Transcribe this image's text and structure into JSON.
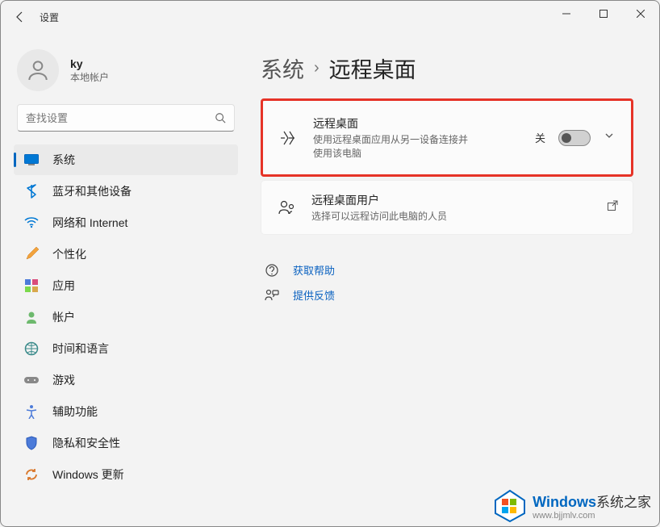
{
  "window": {
    "title": "设置"
  },
  "user": {
    "name": "ky",
    "subtitle": "本地帐户"
  },
  "search": {
    "placeholder": "查找设置"
  },
  "nav": {
    "items": [
      {
        "label": "系统"
      },
      {
        "label": "蓝牙和其他设备"
      },
      {
        "label": "网络和 Internet"
      },
      {
        "label": "个性化"
      },
      {
        "label": "应用"
      },
      {
        "label": "帐户"
      },
      {
        "label": "时间和语言"
      },
      {
        "label": "游戏"
      },
      {
        "label": "辅助功能"
      },
      {
        "label": "隐私和安全性"
      },
      {
        "label": "Windows 更新"
      }
    ]
  },
  "breadcrumb": {
    "parent": "系统",
    "current": "远程桌面"
  },
  "cards": {
    "remote": {
      "title": "远程桌面",
      "subtitle": "使用远程桌面应用从另一设备连接并使用该电脑",
      "toggle_label": "关"
    },
    "users": {
      "title": "远程桌面用户",
      "subtitle": "选择可以远程访问此电脑的人员"
    }
  },
  "links": {
    "help": "获取帮助",
    "feedback": "提供反馈"
  },
  "watermark": {
    "brand": "Windows",
    "suffix": "系统之家",
    "url": "www.bjjmlv.com"
  }
}
